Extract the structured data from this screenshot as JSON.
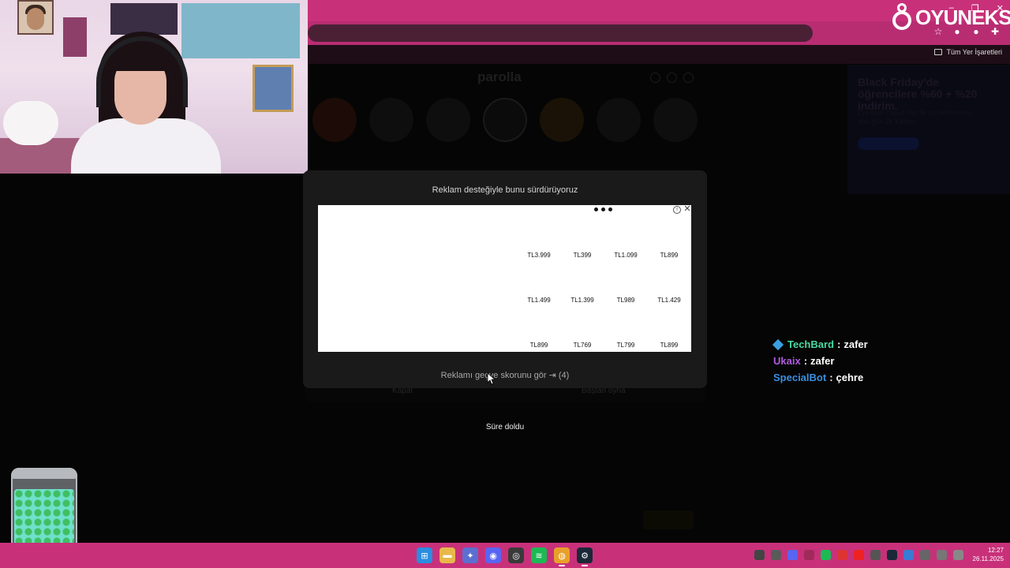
{
  "browser": {
    "bookmarks_all_label": "Tüm Yer İşaretleri",
    "window_controls": {
      "minimize": "–",
      "restore": "❐",
      "close": "✕"
    }
  },
  "logo": {
    "text": "OYUNEKS"
  },
  "game": {
    "title": "parolla",
    "behind_buttons": {
      "close": "Kapat",
      "replay": "Baştan oyna"
    },
    "status": "Süre doldu"
  },
  "side_ad": {
    "title": "Black Friday'de öğrencilere %60 + %20 indirim.",
    "body": "Creative Cloud Pro ilk yıl indiriminde son gün 26 Kasım.",
    "button": "Şimdi satın alın"
  },
  "modal": {
    "title": "Reklam desteğiyle bunu sürdürüyoruz",
    "ad": {
      "info_icon": "i",
      "close_icon": "✕",
      "prices": [
        [
          "TL3.999",
          "TL399",
          "TL1.099",
          "TL899"
        ],
        [
          "TL1.499",
          "TL1.399",
          "TL989",
          "TL1.429"
        ],
        [
          "TL899",
          "TL769",
          "TL799",
          "TL899"
        ]
      ]
    },
    "skip_text": "Reklamı geçve skorunu gör ⇥ (4)"
  },
  "chat": [
    {
      "user": "TechBard",
      "color": "#4ad9a0",
      "message": "zafer",
      "badge": true
    },
    {
      "user": "Ukaix",
      "color": "#b05ce0",
      "message": "zafer",
      "badge": false
    },
    {
      "user": "SpecialBot",
      "color": "#3a8ee0",
      "message": "çehre",
      "badge": false
    }
  ],
  "taskbar": {
    "apps": [
      "windows-start",
      "file-explorer",
      "app-settings",
      "discord",
      "obs-studio",
      "spotify",
      "chrome",
      "steam"
    ],
    "discord_badge": "2"
  },
  "clock": {
    "time": "12:27",
    "date": "26.11.2025"
  }
}
